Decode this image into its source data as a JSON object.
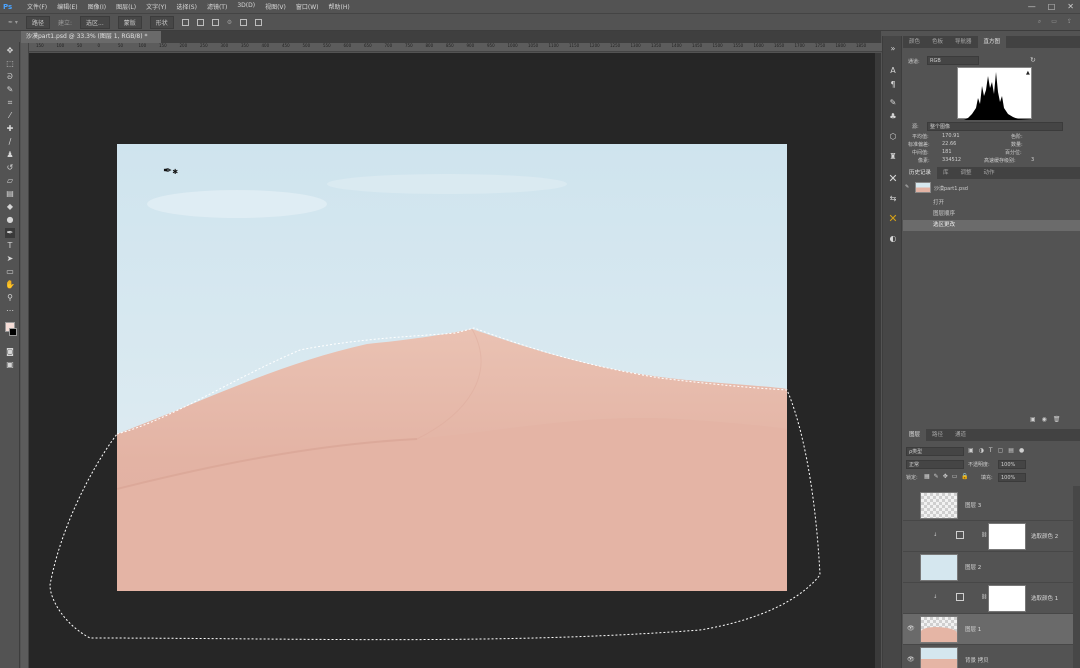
{
  "app": {
    "logo": "Ps"
  },
  "menu": [
    "文件(F)",
    "编辑(E)",
    "图像(I)",
    "图层(L)",
    "文字(Y)",
    "选择(S)",
    "滤镜(T)",
    "3D(D)",
    "视图(V)",
    "窗口(W)",
    "帮助(H)"
  ],
  "window_controls": [
    "—",
    "□",
    "✕"
  ],
  "options_bar": {
    "mode_label": "路径",
    "make_label": "建立:",
    "selection_label": "选区...",
    "mask_label": "蒙版",
    "shape_label": "形状"
  },
  "document_tab": "沙漠part1.psd @ 33.3% (图层 1, RGB/8) *",
  "ruler_ticks": [
    "150",
    "100",
    "50",
    "0",
    "50",
    "100",
    "150",
    "200",
    "250",
    "300",
    "350",
    "400",
    "450",
    "500",
    "550",
    "600",
    "650",
    "700",
    "750",
    "800",
    "850",
    "900",
    "950",
    "1000",
    "1050",
    "1100",
    "1150",
    "1200",
    "1250",
    "1300",
    "1350",
    "1400",
    "1450",
    "1500",
    "1550",
    "1600",
    "1650",
    "1700",
    "1750",
    "1800",
    "1850"
  ],
  "histogram_panel": {
    "tabs": [
      "颜色",
      "色板",
      "导航器",
      "直方图"
    ],
    "channel_label": "通道:",
    "channel_value": "RGB",
    "source_label": "源:",
    "source_value": "整个图像",
    "stats_left": [
      {
        "label": "平均值:",
        "value": "170.91"
      },
      {
        "label": "标准偏差:",
        "value": "22.66"
      },
      {
        "label": "中间值:",
        "value": "181"
      },
      {
        "label": "像素:",
        "value": "334512"
      }
    ],
    "stats_right": [
      {
        "label": "色阶:",
        "value": ""
      },
      {
        "label": "数量:",
        "value": ""
      },
      {
        "label": "百分位:",
        "value": ""
      },
      {
        "label": "高速缓存级别:",
        "value": "3"
      }
    ]
  },
  "history_panel": {
    "tabs": [
      "历史记录",
      "库",
      "调整",
      "动作"
    ],
    "snapshot": "沙漠part1.psd",
    "items": [
      "打开",
      "图层顺序",
      "选区更改"
    ]
  },
  "layers_panel": {
    "tabs": [
      "图层",
      "路径",
      "通道"
    ],
    "filter_label": "ρ类型",
    "blend_mode": "正常",
    "opacity_label": "不透明度:",
    "opacity_value": "100%",
    "lock_label": "锁定:",
    "fill_label": "填充:",
    "fill_value": "100%",
    "layers": [
      {
        "name": "图层 3",
        "kind": "transparent",
        "visible": false,
        "selected": false
      },
      {
        "name": "选取颜色 2",
        "kind": "adjustment",
        "visible": false,
        "selected": false
      },
      {
        "name": "图层 2",
        "kind": "sky",
        "visible": false,
        "selected": false
      },
      {
        "name": "选取颜色 1",
        "kind": "adjustment",
        "visible": false,
        "selected": false
      },
      {
        "name": "图层 1",
        "kind": "dune-cut",
        "visible": true,
        "selected": true
      },
      {
        "name": "背景 拷贝",
        "kind": "dune",
        "visible": true,
        "selected": false
      }
    ]
  },
  "colors": {
    "accent": "#4aa3ff",
    "sky": "#d5e7ef",
    "sand": "#e5b5a5"
  }
}
